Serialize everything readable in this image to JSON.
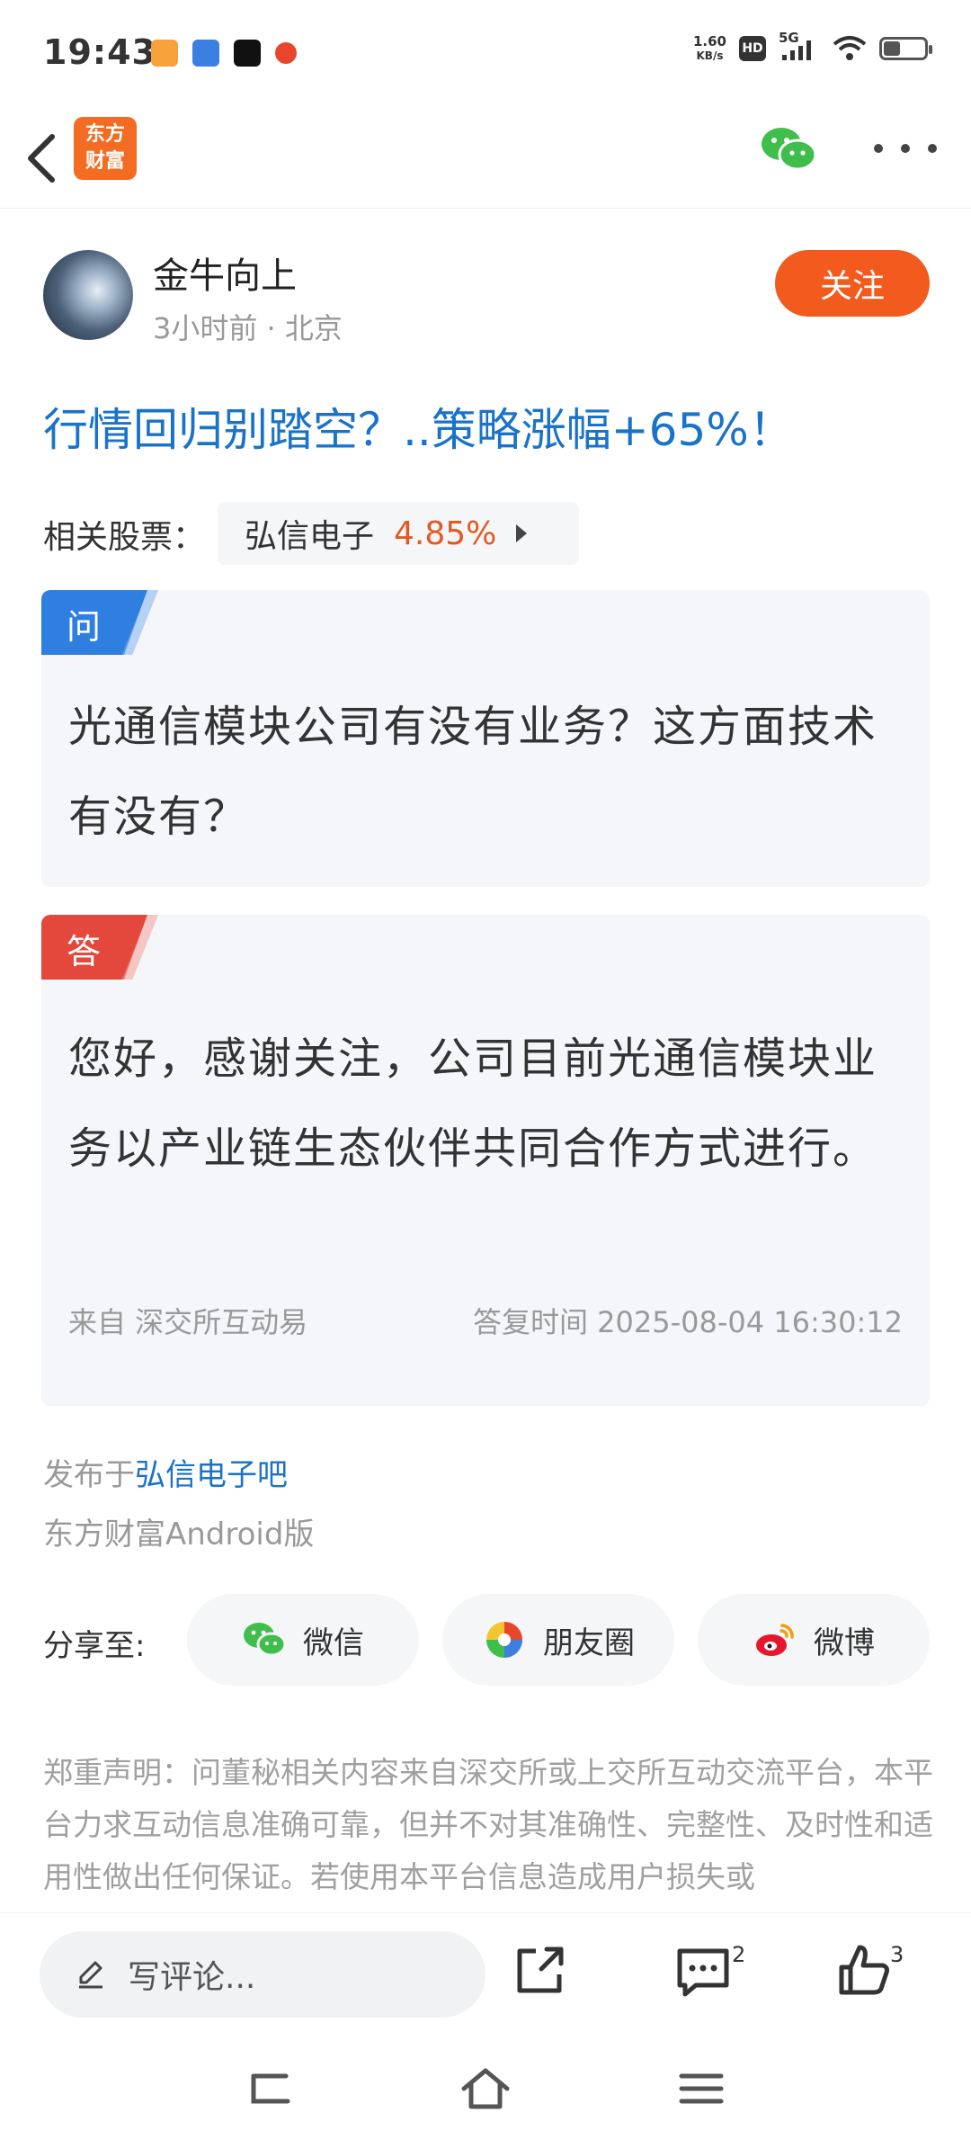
{
  "status_bar": {
    "time": "19:43",
    "net_speed_value": "1.60",
    "net_speed_unit": "KB/s",
    "hd": "HD",
    "signal": "5G"
  },
  "header": {
    "logo_line1": "东方",
    "logo_line2": "财富"
  },
  "author": {
    "name": "金牛向上",
    "time": "3小时前",
    "location": "北京",
    "follow_label": "关注"
  },
  "post": {
    "title": "行情回归别踏空？..策略涨幅+65%！",
    "related_label": "相关股票：",
    "stock_name": "弘信电子",
    "stock_change": "4.85%"
  },
  "question": {
    "tag": "问",
    "text": "光通信模块公司有没有业务？这方面技术有没有？"
  },
  "answer": {
    "tag": "答",
    "text": "您好，感谢关注，公司目前光通信模块业务以产业链生态伙伴共同合作方式进行。",
    "source": "来自 深交所互动易",
    "reply_time": "答复时间 2025-08-04 16:30:12"
  },
  "publish": {
    "prefix": "发布于",
    "bar_link": "弘信电子吧",
    "client": "东方财富Android版"
  },
  "share": {
    "label": "分享至:",
    "wechat": "微信",
    "moments": "朋友圈",
    "weibo": "微博"
  },
  "disclaimer": "郑重声明：问董秘相关内容来自深交所或上交所互动交流平台，本平台力求互动信息准确可靠，但并不对其准确性、完整性、及时性和适用性做出任何保证。若使用本平台信息造成用户损失或",
  "bottom_bar": {
    "comment_placeholder": "写评论...",
    "comment_count": "2",
    "like_count": "3"
  },
  "colors": {
    "accent_orange": "#f25a1e",
    "title_blue": "#1a73c9",
    "stock_up": "#e15a24",
    "q_tag": "#2f7fe0",
    "a_tag": "#e4473b"
  }
}
